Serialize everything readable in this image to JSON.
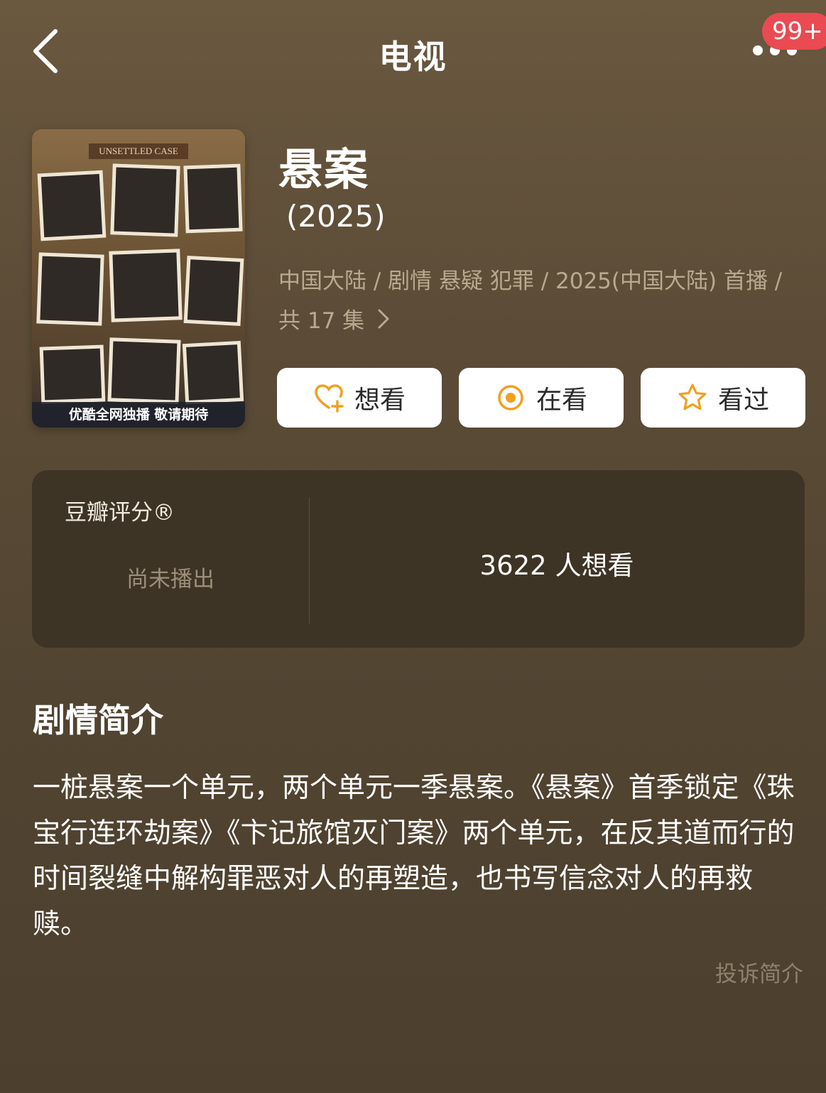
{
  "nav": {
    "title": "电视",
    "badge": "99+"
  },
  "poster": {
    "label": "UNSETTLED CASE",
    "strip": "优酷全网独播 敬请期待"
  },
  "show": {
    "title": "悬案",
    "year": "(2025)",
    "meta_line1": "中国大陆 / 剧情 悬疑 犯罪 / 2025(中国大陆) 首播 /",
    "meta_line2": "共 17 集"
  },
  "actions": [
    {
      "label": "想看",
      "icon": "heart-plus-icon"
    },
    {
      "label": "在看",
      "icon": "target-icon"
    },
    {
      "label": "看过",
      "icon": "star-icon"
    }
  ],
  "rating": {
    "label": "豆瓣评分®",
    "status": "尚未播出",
    "want_count": "3622 人想看"
  },
  "synopsis": {
    "title": "剧情简介",
    "text": "一桩悬案一个单元，两个单元一季悬案。《悬案》首季锁定《珠宝行连环劫案》《卞记旅馆灭门案》两个单元，在反其道而行的时间裂缝中解构罪恶对人的再塑造，也书写信念对人的再救赎。",
    "complain": "投诉简介"
  },
  "colors": {
    "accent": "#f0a020",
    "badge": "#ea4a52",
    "card": "#3e3426"
  }
}
